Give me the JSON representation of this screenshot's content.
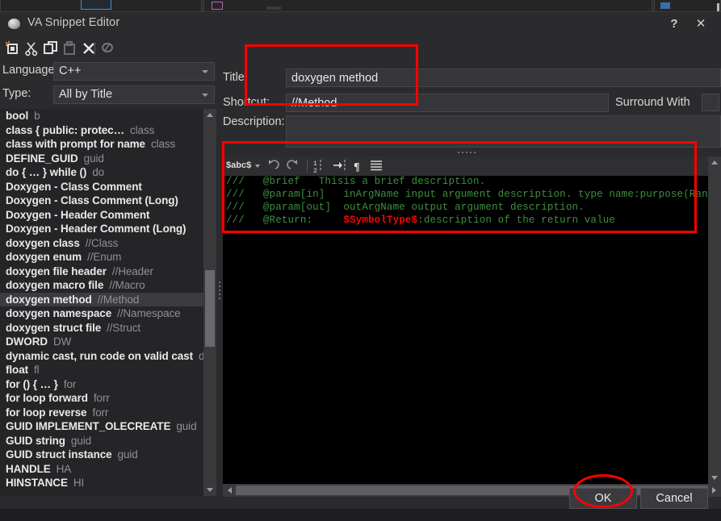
{
  "window": {
    "title": "VA Snippet Editor",
    "icon": "app-globe-icon",
    "help_label": "?",
    "close_label": "✕"
  },
  "toolbar": {
    "items": [
      {
        "name": "new-snippet-icon",
        "tooltip": "New"
      },
      {
        "name": "cut-icon",
        "tooltip": "Cut"
      },
      {
        "name": "copy-icon",
        "tooltip": "Copy"
      },
      {
        "name": "paste-icon",
        "tooltip": "Paste"
      },
      {
        "name": "delete-icon",
        "tooltip": "Delete"
      },
      {
        "name": "find-icon",
        "tooltip": "Find"
      }
    ]
  },
  "filters": {
    "language_label": "Language:",
    "language_value": "C++",
    "type_label": "Type:",
    "type_value": "All by Title"
  },
  "snippets": [
    {
      "title": "bool",
      "shortcut": "b",
      "selected": false
    },
    {
      "title": "class  { public: protec…",
      "shortcut": "class",
      "selected": false
    },
    {
      "title": "class with prompt for name",
      "shortcut": "class",
      "selected": false
    },
    {
      "title": "DEFINE_GUID",
      "shortcut": "guid",
      "selected": false
    },
    {
      "title": "do { … } while ()",
      "shortcut": "do",
      "selected": false
    },
    {
      "title": "Doxygen - Class Comment",
      "shortcut": "",
      "selected": false
    },
    {
      "title": "Doxygen - Class Comment (Long)",
      "shortcut": "",
      "selected": false
    },
    {
      "title": "Doxygen - Header Comment",
      "shortcut": "",
      "selected": false
    },
    {
      "title": "Doxygen - Header Comment (Long)",
      "shortcut": "",
      "selected": false
    },
    {
      "title": "doxygen class",
      "shortcut": "//Class",
      "selected": false
    },
    {
      "title": "doxygen enum",
      "shortcut": "//Enum",
      "selected": false
    },
    {
      "title": "doxygen file header",
      "shortcut": "//Header",
      "selected": false
    },
    {
      "title": "doxygen macro file",
      "shortcut": "//Macro",
      "selected": false
    },
    {
      "title": "doxygen method",
      "shortcut": "//Method",
      "selected": true
    },
    {
      "title": "doxygen namespace",
      "shortcut": "//Namespace",
      "selected": false
    },
    {
      "title": "doxygen struct file",
      "shortcut": "//Struct",
      "selected": false
    },
    {
      "title": "DWORD",
      "shortcut": "DW",
      "selected": false
    },
    {
      "title": "dynamic cast, run code on valid cast",
      "shortcut": "dy",
      "selected": false
    },
    {
      "title": "float",
      "shortcut": "fl",
      "selected": false
    },
    {
      "title": "for () { … }",
      "shortcut": "for",
      "selected": false
    },
    {
      "title": "for loop forward",
      "shortcut": "forr",
      "selected": false
    },
    {
      "title": "for loop reverse",
      "shortcut": "forr",
      "selected": false
    },
    {
      "title": "GUID IMPLEMENT_OLECREATE",
      "shortcut": "guid",
      "selected": false
    },
    {
      "title": "GUID string",
      "shortcut": "guid",
      "selected": false
    },
    {
      "title": "GUID struct instance",
      "shortcut": "guid",
      "selected": false
    },
    {
      "title": "HANDLE",
      "shortcut": "HA",
      "selected": false
    },
    {
      "title": "HINSTANCE",
      "shortcut": "HI",
      "selected": false
    }
  ],
  "details": {
    "title_label": "Title:",
    "title_value": "doxygen method",
    "shortcut_label": "Shortcut:",
    "shortcut_value": "//Method",
    "surround_with_label": "Surround With",
    "surround_with_checked": false,
    "description_label": "Description:",
    "description_value": ""
  },
  "editor": {
    "scope_label": "$abc$",
    "tools": [
      {
        "name": "undo-icon"
      },
      {
        "name": "redo-icon"
      },
      {
        "name": "line-numbers-icon"
      },
      {
        "name": "insert-tab-icon"
      },
      {
        "name": "pilcrow-icon"
      },
      {
        "name": "word-wrap-icon"
      }
    ],
    "code_lines": [
      {
        "parts": [
          {
            "text": "///   @brief   Thisis a brief description.",
            "style": "comment"
          }
        ]
      },
      {
        "parts": [
          {
            "text": "///   @param[in]   inArgName input argument description. type name:purpose(Range)",
            "style": "comment"
          }
        ]
      },
      {
        "parts": [
          {
            "text": "///   @param[out]  outArgName output argument description.",
            "style": "comment"
          }
        ]
      },
      {
        "parts": [
          {
            "text": "///   @Return:     ",
            "style": "comment"
          },
          {
            "text": "$SymbolType$",
            "style": "symbol"
          },
          {
            "text": ":description of the return value",
            "style": "comment"
          }
        ]
      }
    ]
  },
  "footer": {
    "ok_label": "OK",
    "cancel_label": "Cancel"
  },
  "annotations": {
    "color": "#fe0000",
    "shapes": [
      {
        "name": "title-shortcut-highlight",
        "type": "rect"
      },
      {
        "name": "code-editor-highlight",
        "type": "rect"
      },
      {
        "name": "ok-button-highlight",
        "type": "ellipse"
      }
    ]
  }
}
